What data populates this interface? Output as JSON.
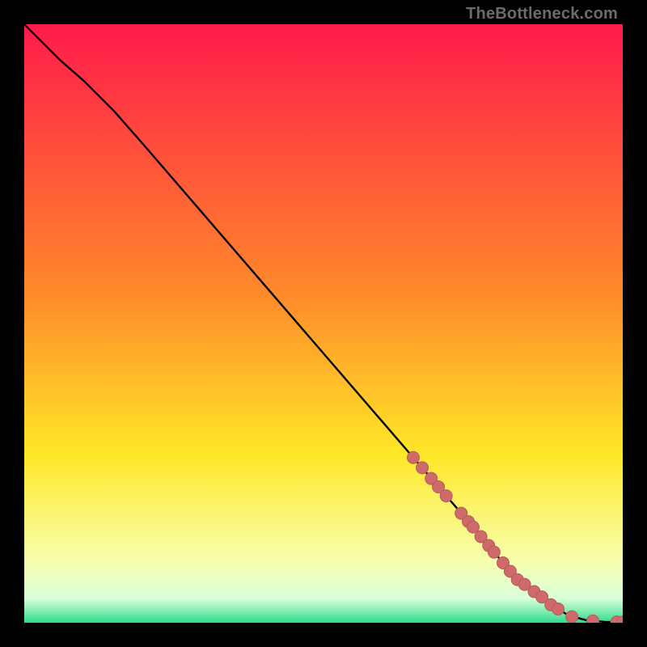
{
  "watermark": "TheBottleneck.com",
  "colors": {
    "gradient_top": "#ff1a4b",
    "gradient_mid1": "#ff8a2a",
    "gradient_mid2": "#ffe828",
    "gradient_mid3": "#f7ffb0",
    "gradient_bottom": "#2edc8c",
    "line": "#000000",
    "marker_fill": "#cf6a6a",
    "marker_stroke": "#b85a5a"
  },
  "chart_data": {
    "type": "line",
    "title": "",
    "xlabel": "",
    "ylabel": "",
    "xlim": [
      0,
      100
    ],
    "ylim": [
      0,
      100
    ],
    "grid": false,
    "series": [
      {
        "name": "curve",
        "x": [
          0,
          3,
          6,
          10,
          15,
          20,
          25,
          30,
          35,
          40,
          45,
          50,
          55,
          60,
          65,
          70,
          75,
          80,
          84,
          88,
          91,
          94,
          97,
          100
        ],
        "y": [
          100,
          97,
          94,
          90.5,
          85.5,
          79.8,
          74,
          68.2,
          62.4,
          56.6,
          50.8,
          45,
          39.2,
          33.4,
          27.6,
          21.8,
          16,
          10,
          6,
          3,
          1.2,
          0.4,
          0.15,
          0.1
        ]
      }
    ],
    "markers": {
      "name": "data-points",
      "x": [
        65,
        66.5,
        68,
        69.2,
        70.5,
        73,
        74.2,
        75,
        76.3,
        77.6,
        78.5,
        80,
        81.2,
        82.4,
        83.6,
        85.2,
        86.5,
        88,
        89.2,
        91.5,
        95,
        99,
        100
      ],
      "y": [
        27.6,
        25.9,
        24.1,
        22.7,
        21.2,
        18.3,
        16.9,
        16,
        14.4,
        12.9,
        11.8,
        10,
        8.6,
        7.2,
        6.4,
        5.2,
        4.3,
        3.0,
        2.3,
        1.0,
        0.3,
        0.12,
        0.1
      ]
    }
  }
}
